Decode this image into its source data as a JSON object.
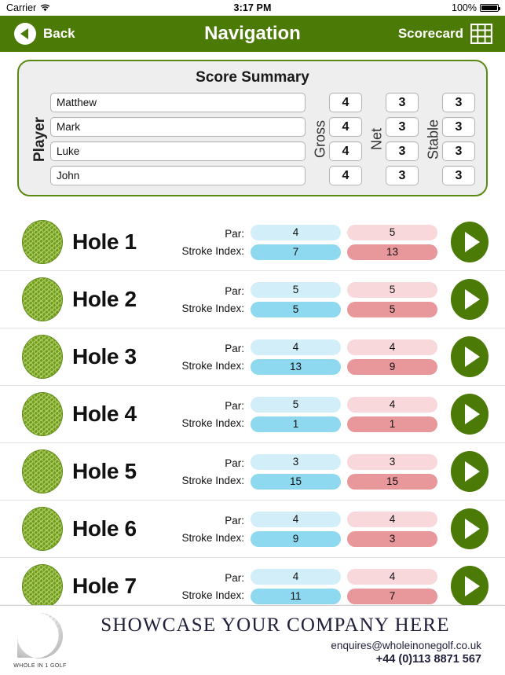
{
  "statusbar": {
    "carrier": "Carrier",
    "wifi_icon": "wifi-icon",
    "time": "3:17 PM",
    "battery_percent": "100%",
    "battery_icon": "battery-full-icon"
  },
  "navbar": {
    "back_label": "Back",
    "back_icon": "back-chevron-circle-icon",
    "title": "Navigation",
    "scorecard_label": "Scorecard",
    "scorecard_icon": "grid-table-icon",
    "background_color": "#4c7a06"
  },
  "summary": {
    "title": "Score Summary",
    "player_label": "Player",
    "gross_label": "Gross",
    "net_label": "Net",
    "stable_label": "Stable",
    "rows": [
      {
        "name": "Matthew",
        "gross": "4",
        "net": "3",
        "stable": "3"
      },
      {
        "name": "Mark",
        "gross": "4",
        "net": "3",
        "stable": "3"
      },
      {
        "name": "Luke",
        "gross": "4",
        "net": "3",
        "stable": "3"
      },
      {
        "name": "John",
        "gross": "4",
        "net": "3",
        "stable": "3"
      }
    ],
    "border_color": "#5a8a14",
    "fill_color": "#eeeeee"
  },
  "holes_labels": {
    "par": "Par:",
    "stroke_index": "Stroke Index:"
  },
  "holes": [
    {
      "name": "Hole 1",
      "par_blue": "4",
      "si_blue": "7",
      "par_pink": "5",
      "si_pink": "13"
    },
    {
      "name": "Hole 2",
      "par_blue": "5",
      "si_blue": "5",
      "par_pink": "5",
      "si_pink": "5"
    },
    {
      "name": "Hole 3",
      "par_blue": "4",
      "si_blue": "13",
      "par_pink": "4",
      "si_pink": "9"
    },
    {
      "name": "Hole 4",
      "par_blue": "5",
      "si_blue": "1",
      "par_pink": "4",
      "si_pink": "1"
    },
    {
      "name": "Hole 5",
      "par_blue": "3",
      "si_blue": "15",
      "par_pink": "3",
      "si_pink": "15"
    },
    {
      "name": "Hole 6",
      "par_blue": "4",
      "si_blue": "9",
      "par_pink": "4",
      "si_pink": "3"
    },
    {
      "name": "Hole 7",
      "par_blue": "4",
      "si_blue": "11",
      "par_pink": "4",
      "si_pink": "7"
    }
  ],
  "colors": {
    "par_blue": "#d2eef8",
    "si_blue": "#8fd9f0",
    "par_pink": "#f8d8da",
    "si_pink": "#e8979b",
    "green": "#4c7a06",
    "ball_green": "#6d9b1e"
  },
  "banner": {
    "logo_icon": "golf-ball-logo-icon",
    "logo_caption": "WHOLE IN 1 GOLF",
    "headline": "SHOWCASE YOUR COMPANY HERE",
    "email": "enquires@wholeinonegolf.co.uk",
    "phone": "+44 (0)113 8871 567"
  }
}
